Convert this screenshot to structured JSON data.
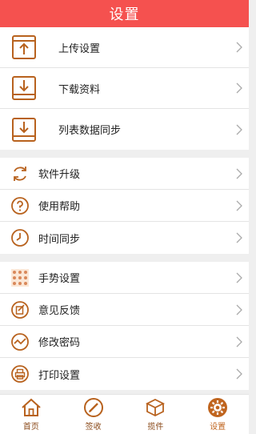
{
  "header": {
    "title": "设置"
  },
  "colors": {
    "accent": "#f5514f",
    "icon": "#b8621e"
  },
  "groups": [
    {
      "items": [
        {
          "label": "上传设置",
          "icon": "upload-icon"
        },
        {
          "label": "下载资料",
          "icon": "download-icon"
        },
        {
          "label": "列表数据同步",
          "icon": "sync-list-icon"
        }
      ]
    },
    {
      "items": [
        {
          "label": "软件升级",
          "icon": "refresh-icon"
        },
        {
          "label": "使用帮助",
          "icon": "help-icon"
        },
        {
          "label": "时间同步",
          "icon": "clock-icon"
        }
      ]
    },
    {
      "items": [
        {
          "label": "手势设置",
          "icon": "gesture-grid-icon"
        },
        {
          "label": "意见反馈",
          "icon": "feedback-icon"
        },
        {
          "label": "修改密码",
          "icon": "password-icon"
        },
        {
          "label": "打印设置",
          "icon": "printer-icon"
        }
      ]
    }
  ],
  "tabs": [
    {
      "label": "首页",
      "icon": "home-icon"
    },
    {
      "label": "签收",
      "icon": "sign-icon"
    },
    {
      "label": "揽件",
      "icon": "package-icon"
    },
    {
      "label": "设置",
      "icon": "settings-icon",
      "active": true
    }
  ]
}
